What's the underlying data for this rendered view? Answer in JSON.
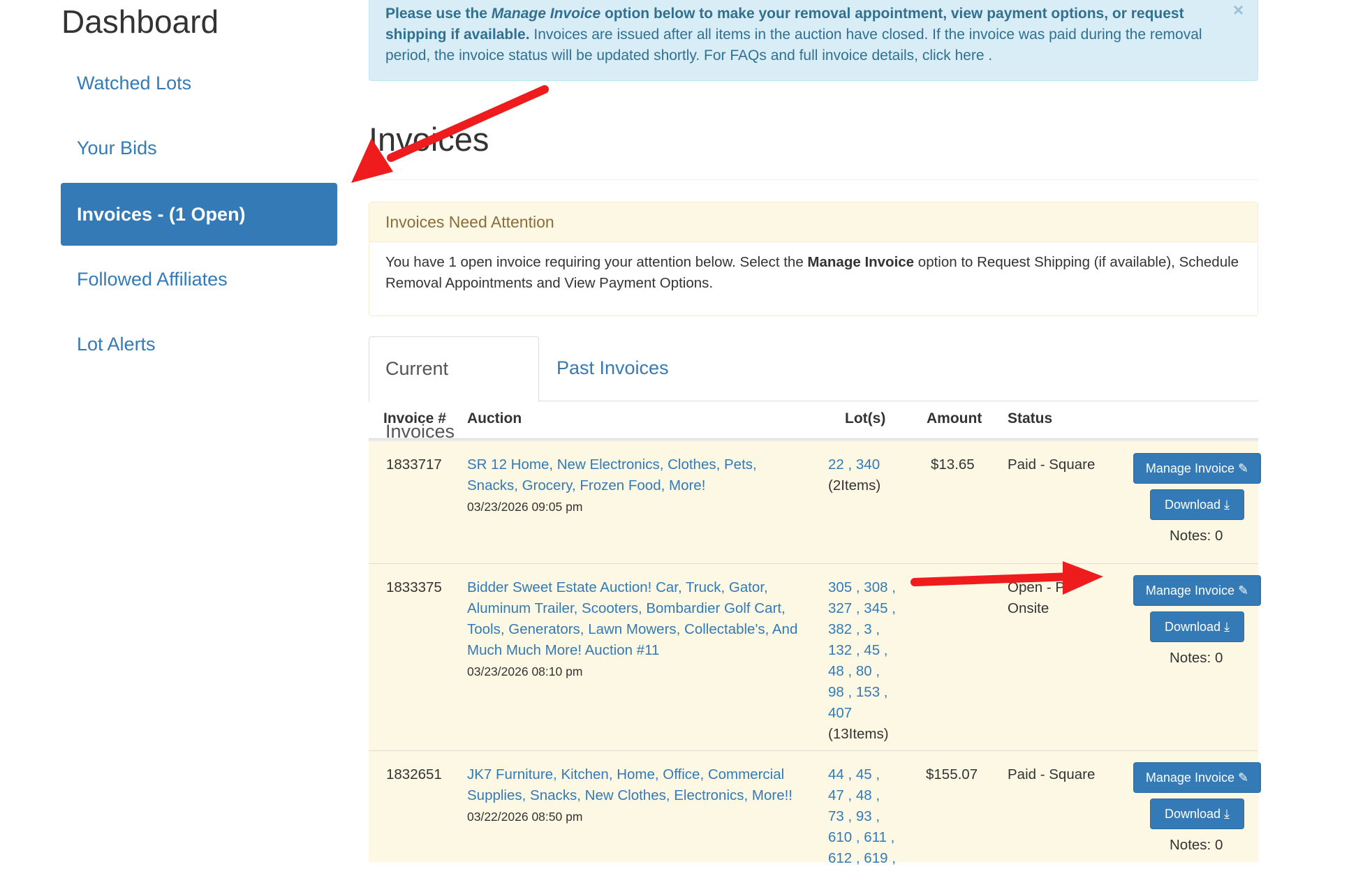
{
  "sidebar": {
    "title": "Dashboard",
    "items": [
      {
        "label": "Watched Lots"
      },
      {
        "label": "Your Bids"
      },
      {
        "label": "Invoices - (1 Open)"
      },
      {
        "label": "Followed Affiliates"
      },
      {
        "label": "Lot Alerts"
      }
    ]
  },
  "alert": {
    "bold_intro_1": "Please use the ",
    "bold_italic": "Manage Invoice",
    "bold_intro_2": " option below to make your removal appointment, view payment options, or request shipping if available.",
    "text": " Invoices are issued after all items in the auction have closed. If the invoice was paid during the removal period, the invoice status will be updated shortly. For FAQs and full invoice details, click here .",
    "close": "×"
  },
  "page_title": "Invoices",
  "attention_panel": {
    "heading": "Invoices Need Attention",
    "body_1": "You have 1 open invoice requiring your attention below. Select the ",
    "body_bold": "Manage Invoice",
    "body_2": " option to Request Shipping (if available), Schedule Removal Appointments and View Payment Options."
  },
  "tabs": [
    {
      "label": "Current Invoices"
    },
    {
      "label": "Past Invoices"
    }
  ],
  "table": {
    "headers": {
      "invoice": "Invoice #",
      "auction": "Auction",
      "lots": "Lot(s)",
      "amount": "Amount",
      "status": "Status"
    },
    "rows": [
      {
        "invoice": "1833717",
        "auction_lines": [
          "SR 12 Home, New Electronics, Clothes, Pets,",
          "Snacks, Grocery, Frozen Food, More!"
        ],
        "date": "03/23/2026 09:05 pm",
        "lot_lines": [
          "22 , 340"
        ],
        "lot_count": "(2Items)",
        "amount": "$13.65",
        "status_lines": [
          "Paid - Square"
        ],
        "manage": "Manage Invoice",
        "download": "Download",
        "notes": "Notes: 0"
      },
      {
        "invoice": "1833375",
        "auction_lines": [
          "Bidder Sweet Estate Auction! Car, Truck, Gator,",
          "Aluminum Trailer, Scooters, Bombardier Golf Cart,",
          "Tools, Generators, Lawn Mowers, Collectable's, And",
          "Much Much More! Auction #11"
        ],
        "date": "03/23/2026 08:10 pm",
        "lot_lines": [
          "305 , 308 ,",
          "327 , 345 ,",
          "382 , 3 ,",
          "132 , 45 ,",
          "48 , 80 ,",
          "98 , 153 ,",
          "407"
        ],
        "lot_count": "(13Items)",
        "amount": "",
        "status_lines": [
          "Open - P",
          "Onsite"
        ],
        "manage": "Manage Invoice",
        "download": "Download",
        "notes": "Notes: 0"
      },
      {
        "invoice": "1832651",
        "auction_lines": [
          "JK7 Furniture, Kitchen, Home, Office, Commercial",
          "Supplies, Snacks, New Clothes, Electronics, More!!"
        ],
        "date": "03/22/2026 08:50 pm",
        "lot_lines": [
          "44 , 45 ,",
          "47 , 48 ,",
          "73 , 93 ,",
          "610 , 611 ,",
          "612 , 619 ,"
        ],
        "lot_count": "",
        "amount": "$155.07",
        "status_lines": [
          "Paid - Square"
        ],
        "manage": "Manage Invoice",
        "download": "Download",
        "notes": "Notes: 0"
      }
    ]
  },
  "annotation_color": "#ee1c1c"
}
